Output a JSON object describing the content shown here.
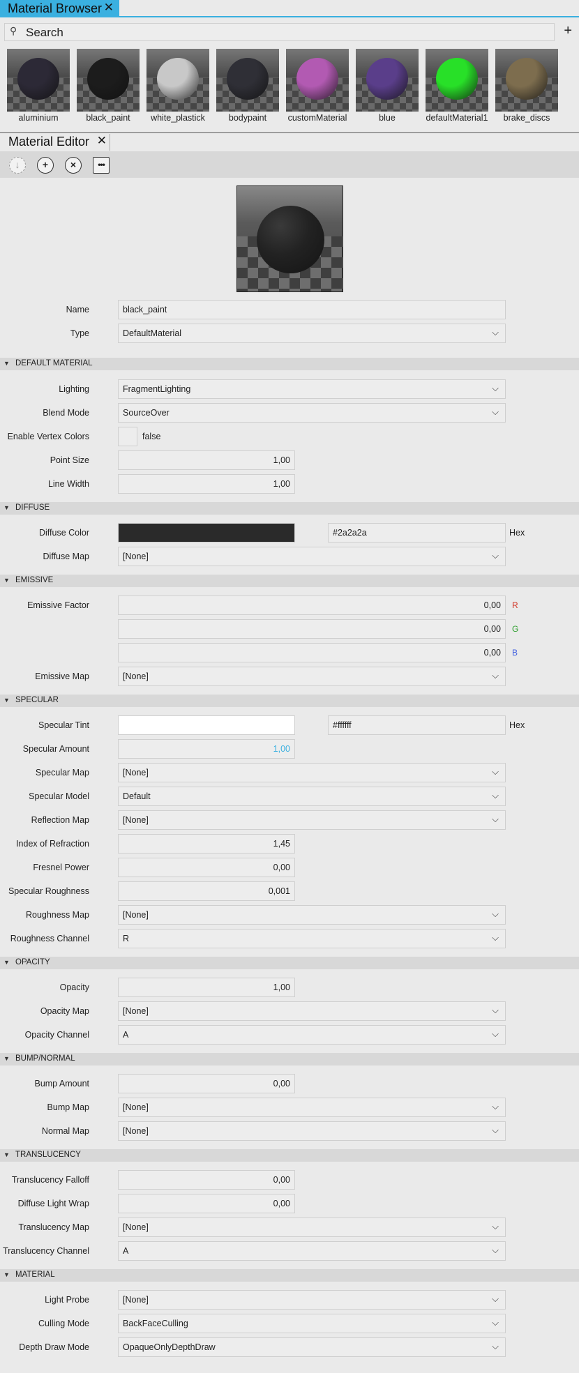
{
  "browser": {
    "tab_title": "Material Browser",
    "search_placeholder": "Search",
    "add_icon": "plus-icon",
    "materials": [
      {
        "name": "aluminium",
        "color": "#2c2936"
      },
      {
        "name": "black_paint",
        "color": "#1c1c1c",
        "selected": true
      },
      {
        "name": "white_plastick",
        "color": "#c8c8c8"
      },
      {
        "name": "bodypaint",
        "color": "#2f2f36"
      },
      {
        "name": "customMaterial",
        "color": "#b25ab2"
      },
      {
        "name": "blue",
        "color": "#5a3e8a"
      },
      {
        "name": "defaultMaterial1",
        "color": "#28e028"
      },
      {
        "name": "brake_discs",
        "color": "#7d6d4e"
      }
    ]
  },
  "editor": {
    "tab_title": "Material Editor",
    "toolbar": {
      "apply_icon": "download-icon",
      "new_icon": "plus-circle-icon",
      "delete_icon": "close-circle-icon",
      "more_icon": "grid-dots-icon"
    },
    "name_label": "Name",
    "name_value": "black_paint",
    "type_label": "Type",
    "type_value": "DefaultMaterial",
    "sections": {
      "default_material": "DEFAULT MATERIAL",
      "diffuse": "DIFFUSE",
      "emissive": "EMISSIVE",
      "specular": "SPECULAR",
      "opacity": "OPACITY",
      "bump": "BUMP/NORMAL",
      "translucency": "TRANSLUCENCY",
      "material": "MATERIAL"
    },
    "lighting_label": "Lighting",
    "lighting_value": "FragmentLighting",
    "blend_label": "Blend Mode",
    "blend_value": "SourceOver",
    "vertex_label": "Enable Vertex Colors",
    "vertex_value": "false",
    "point_label": "Point Size",
    "point_value": "1,00",
    "line_label": "Line Width",
    "line_value": "1,00",
    "diffuse_color_label": "Diffuse Color",
    "diffuse_color_hex": "#2a2a2a",
    "hex_label": "Hex",
    "diffuse_map_label": "Diffuse Map",
    "diffuse_map_value": "[None]",
    "emissive_factor_label": "Emissive Factor",
    "emissive_r": "0,00",
    "emissive_g": "0,00",
    "emissive_b": "0,00",
    "chan_r": "R",
    "chan_g": "G",
    "chan_b": "B",
    "emissive_map_label": "Emissive Map",
    "emissive_map_value": "[None]",
    "spec_tint_label": "Specular Tint",
    "spec_tint_hex": "#ffffff",
    "spec_amount_label": "Specular Amount",
    "spec_amount_value": "1,00",
    "spec_map_label": "Specular Map",
    "spec_map_value": "[None]",
    "spec_model_label": "Specular Model",
    "spec_model_value": "Default",
    "reflection_label": "Reflection Map",
    "reflection_value": "[None]",
    "ior_label": "Index of Refraction",
    "ior_value": "1,45",
    "fresnel_label": "Fresnel Power",
    "fresnel_value": "0,00",
    "roughness_label": "Specular Roughness",
    "roughness_value": "0,001",
    "rough_map_label": "Roughness Map",
    "rough_map_value": "[None]",
    "rough_chan_label": "Roughness Channel",
    "rough_chan_value": "R",
    "opacity_label": "Opacity",
    "opacity_value": "1,00",
    "opacity_map_label": "Opacity Map",
    "opacity_map_value": "[None]",
    "opacity_chan_label": "Opacity Channel",
    "opacity_chan_value": "A",
    "bump_amount_label": "Bump Amount",
    "bump_amount_value": "0,00",
    "bump_map_label": "Bump Map",
    "bump_map_value": "[None]",
    "normal_map_label": "Normal Map",
    "normal_map_value": "[None]",
    "trans_falloff_label": "Translucency Falloff",
    "trans_falloff_value": "0,00",
    "light_wrap_label": "Diffuse Light Wrap",
    "light_wrap_value": "0,00",
    "trans_map_label": "Translucency Map",
    "trans_map_value": "[None]",
    "trans_chan_label": "Translucency Channel",
    "trans_chan_value": "A",
    "light_probe_label": "Light Probe",
    "light_probe_value": "[None]",
    "culling_label": "Culling Mode",
    "culling_value": "BackFaceCulling",
    "depth_label": "Depth Draw Mode",
    "depth_value": "OpaqueOnlyDepthDraw"
  },
  "colors": {
    "accent": "#3ab0e0",
    "chan_r": "#d03020",
    "chan_g": "#30a030",
    "chan_b": "#4060e0"
  }
}
